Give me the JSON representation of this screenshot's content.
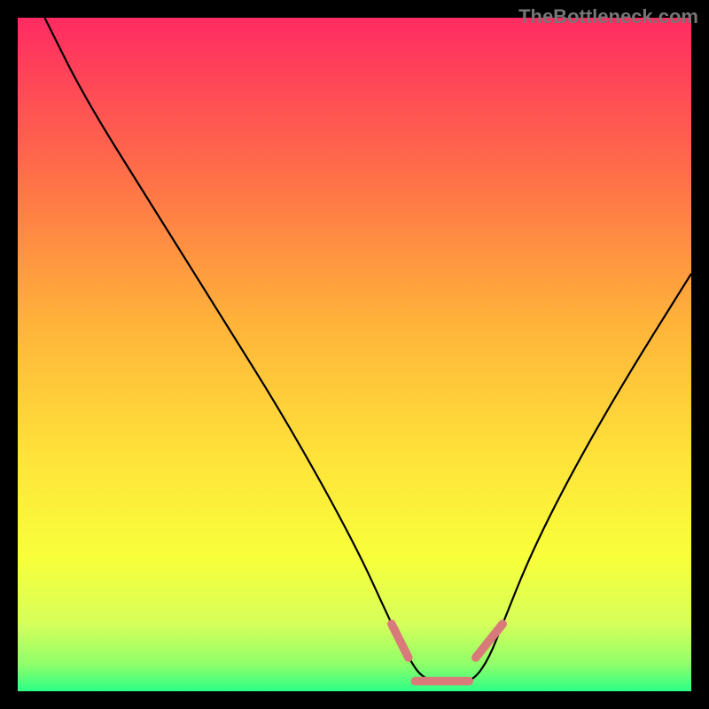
{
  "watermark": "TheBottleneck.com",
  "chart_data": {
    "type": "line",
    "title": "",
    "xlabel": "",
    "ylabel": "",
    "xlim": [
      0,
      100
    ],
    "ylim": [
      0,
      100
    ],
    "series": [
      {
        "name": "bottleneck-curve",
        "color": "#000000",
        "x": [
          4,
          10,
          20,
          30,
          40,
          50,
          55.5,
          58,
          60,
          63,
          66,
          68,
          70,
          72,
          76,
          82,
          90,
          100
        ],
        "y": [
          100,
          88,
          72,
          56,
          40,
          22,
          10,
          5,
          2,
          1.2,
          1.2,
          2,
          5,
          10,
          20,
          32,
          46,
          62
        ]
      },
      {
        "name": "optimal-zone-markers",
        "color": "#d97a7a",
        "stroke_width": 6,
        "segments": [
          {
            "x1": 55.5,
            "y1": 10,
            "x2": 58,
            "y2": 5
          },
          {
            "x1": 59,
            "y1": 1.5,
            "x2": 67,
            "y2": 1.5
          },
          {
            "x1": 68,
            "y1": 5,
            "x2": 72,
            "y2": 10
          }
        ]
      }
    ],
    "background_gradient": {
      "type": "vertical",
      "stops": [
        {
          "offset": 0.0,
          "color": "#ff2b62"
        },
        {
          "offset": 0.22,
          "color": "#ff6b4a"
        },
        {
          "offset": 0.45,
          "color": "#ffb23a"
        },
        {
          "offset": 0.65,
          "color": "#ffe23a"
        },
        {
          "offset": 0.8,
          "color": "#f8ff3a"
        },
        {
          "offset": 0.9,
          "color": "#d6ff5a"
        },
        {
          "offset": 0.96,
          "color": "#8fff6a"
        },
        {
          "offset": 1.0,
          "color": "#2bff86"
        }
      ]
    }
  }
}
